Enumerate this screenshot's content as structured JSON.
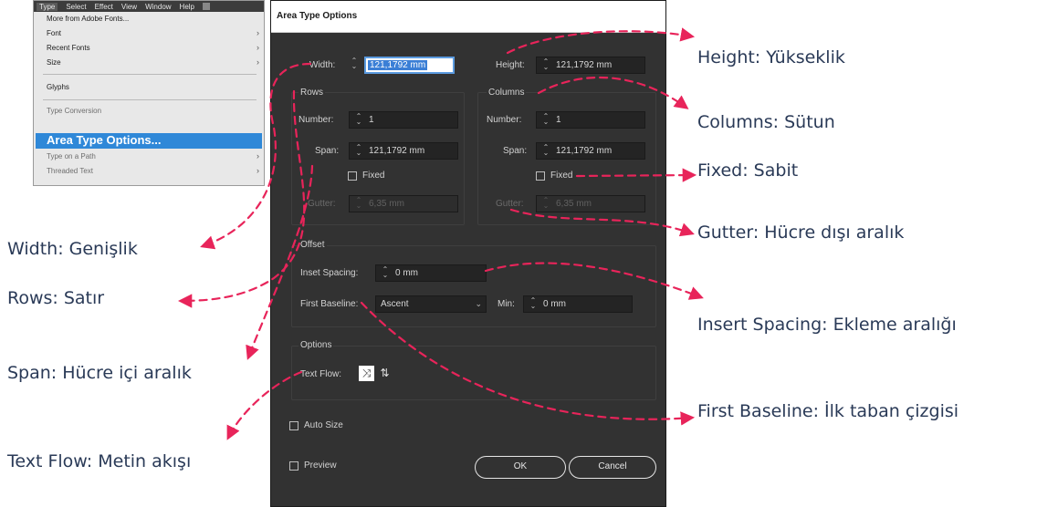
{
  "menu": {
    "bar": [
      "Type",
      "Select",
      "Effect",
      "View",
      "Window",
      "Help"
    ],
    "items": [
      {
        "label": "More from Adobe Fonts...",
        "submenu": false
      },
      {
        "label": "Font",
        "submenu": true
      },
      {
        "label": "Recent Fonts",
        "submenu": true
      },
      {
        "label": "Size",
        "submenu": true
      },
      {
        "label": "Glyphs",
        "submenu": false
      },
      {
        "label": "Type Conversion",
        "submenu": false
      },
      {
        "label": "Area Type Options...",
        "submenu": false
      },
      {
        "label": "Type on a Path",
        "submenu": true
      },
      {
        "label": "Threaded Text",
        "submenu": true
      }
    ]
  },
  "dialog": {
    "title": "Area Type Options",
    "width": {
      "label": "Width:",
      "value": "121,1792 mm"
    },
    "height": {
      "label": "Height:",
      "value": "121,1792 mm"
    },
    "rows": {
      "heading": "Rows",
      "number_label": "Number:",
      "number_value": "1",
      "span_label": "Span:",
      "span_value": "121,1792 mm",
      "fixed_label": "Fixed",
      "gutter_label": "Gutter:",
      "gutter_value": "6,35 mm"
    },
    "columns": {
      "heading": "Columns",
      "number_label": "Number:",
      "number_value": "1",
      "span_label": "Span:",
      "span_value": "121,1792 mm",
      "fixed_label": "Fixed",
      "gutter_label": "Gutter:",
      "gutter_value": "6,35 mm"
    },
    "offset": {
      "heading": "Offset",
      "inset_label": "Inset Spacing:",
      "inset_value": "0 mm",
      "baseline_label": "First Baseline:",
      "baseline_value": "Ascent",
      "min_label": "Min:",
      "min_value": "0 mm"
    },
    "options": {
      "heading": "Options",
      "text_flow_label": "Text Flow:"
    },
    "auto_size_label": "Auto Size",
    "preview_label": "Preview",
    "ok_label": "OK",
    "cancel_label": "Cancel"
  },
  "annotations": {
    "height": "Height: Yükseklik",
    "columns": "Columns: Sütun",
    "fixed": "Fixed: Sabit",
    "gutter": "Gutter: Hücre dışı aralık",
    "inset": "Insert Spacing: Ekleme aralığı",
    "baseline": "First Baseline: İlk taban çizgisi",
    "width": "Width: Genişlik",
    "rows": "Rows: Satır",
    "span": "Span: Hücre içi aralık",
    "text_flow": "Text Flow: Metin akışı"
  },
  "colors": {
    "annotation_line": "#e8245a",
    "annotation_text": "#2a3a57",
    "dialog_bg": "#323232",
    "highlight": "#2f88d8"
  }
}
